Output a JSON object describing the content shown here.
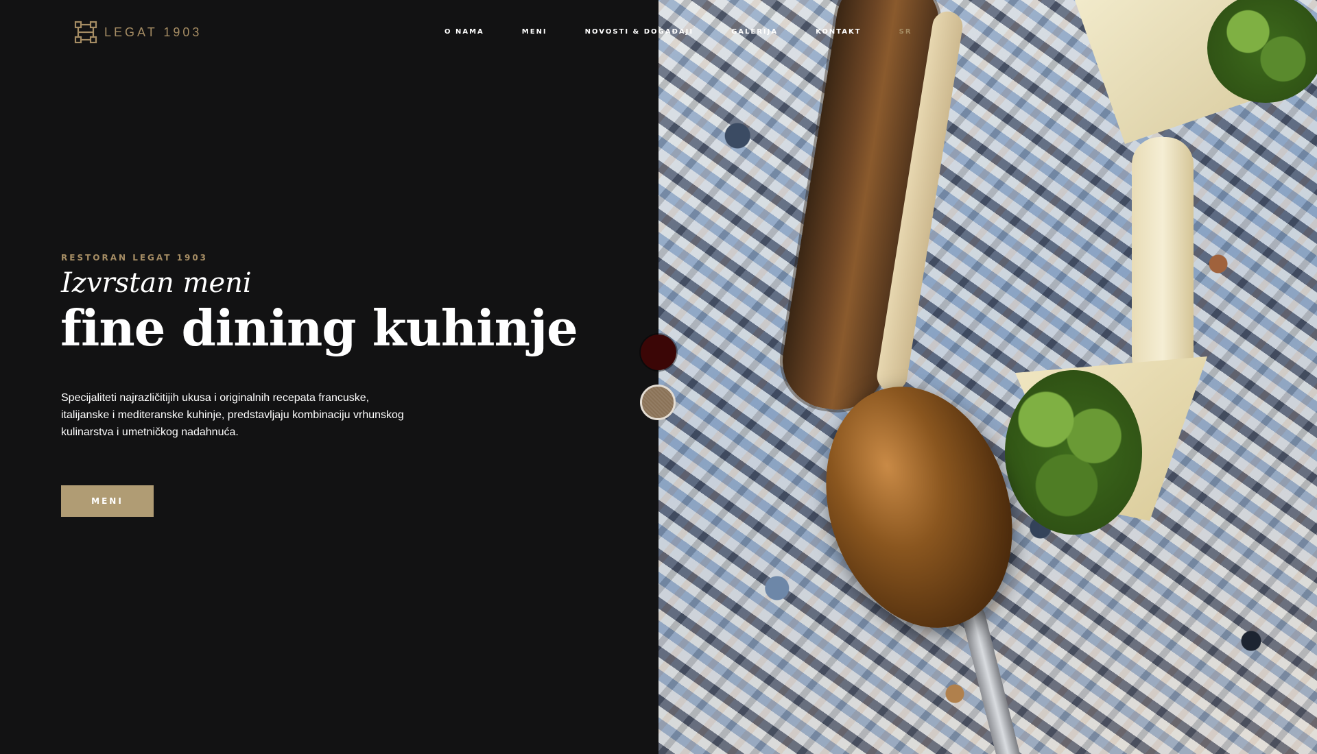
{
  "brand": {
    "logo_text": "LEGAT 1903"
  },
  "nav": {
    "items": [
      {
        "label": "O NAMA"
      },
      {
        "label": "MENI"
      },
      {
        "label": "NOVOSTI & DOGAĐAJI"
      },
      {
        "label": "GALERIJA"
      },
      {
        "label": "KONTAKT"
      }
    ],
    "language": "SR"
  },
  "hero": {
    "eyebrow": "RESTORAN LEGAT 1903",
    "subtitle": "Izvrstan meni",
    "title": "fine dining kuhinje",
    "description": "Specijaliteti najrazličitijih ukusa i originalnih recepata francuske, italijanske i mediteranske kuhinje, predstavljaju kombinaciju vrhunskog kulinarstva i umetničkog nadahnuća.",
    "cta_label": "MENI"
  },
  "theme_switcher": {
    "options": [
      {
        "color": "#3b0606"
      },
      {
        "color": "#8a7257"
      }
    ]
  },
  "colors": {
    "background": "#121213",
    "accent": "#a68d64",
    "button": "#b09c74"
  }
}
